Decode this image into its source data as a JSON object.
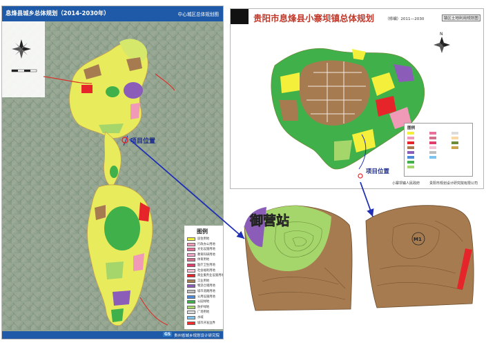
{
  "left_panel": {
    "title": "息烽县城乡总体规划（2014-2030年）",
    "subtitle": "中心城区总体规划图",
    "project_label": "项目位置",
    "footer_logo": "GS",
    "footer_text": "贵州省城乡规划设计研究院",
    "legend": {
      "title": "图例",
      "items": [
        {
          "label": "居住用地",
          "color": "#f3ef3a"
        },
        {
          "label": "行政办公用地",
          "color": "#f19ab8"
        },
        {
          "label": "文化设施用地",
          "color": "#e8709a"
        },
        {
          "label": "教育科研用地",
          "color": "#f2a6c7"
        },
        {
          "label": "体育用地",
          "color": "#d36e8c"
        },
        {
          "label": "医疗卫生用地",
          "color": "#e03d6d"
        },
        {
          "label": "社会福利用地",
          "color": "#f2c2d6"
        },
        {
          "label": "商业服务业设施用地",
          "color": "#e6252a"
        },
        {
          "label": "工业用地",
          "color": "#a77b50"
        },
        {
          "label": "物流仓储用地",
          "color": "#8b5db8"
        },
        {
          "label": "城市道路用地",
          "color": "#bdbdbd"
        },
        {
          "label": "公用设施用地",
          "color": "#4c8ad8"
        },
        {
          "label": "公园绿地",
          "color": "#3fb04a"
        },
        {
          "label": "防护绿地",
          "color": "#a5d66b"
        },
        {
          "label": "广场用地",
          "color": "#dcdcdc"
        },
        {
          "label": "水域",
          "color": "#7dc3f0"
        },
        {
          "label": "城市开发边界",
          "color": "#ff2a2a"
        }
      ]
    }
  },
  "right_panel": {
    "title": "贵阳市息烽县小寨坝镇总体规划",
    "subtitle": "（修编）2011—2030",
    "badge": "镇区土地利用规划图",
    "project_label": "项目位置",
    "legend_title": "图例",
    "footer_left": "小寨坝镇人民政府",
    "footer_right": "贵阳市规划设计研究院有限公司"
  },
  "detail_1": {
    "label": "御营站"
  },
  "detail_2": {
    "label": "M1"
  },
  "colors": {
    "arrow": "#1f2fb5",
    "residential": "#f3ef3a",
    "industrial": "#a77b50",
    "green": "#3fb04a",
    "light_green": "#a5d66b",
    "purple": "#8b5db8",
    "commercial": "#e6252a"
  }
}
